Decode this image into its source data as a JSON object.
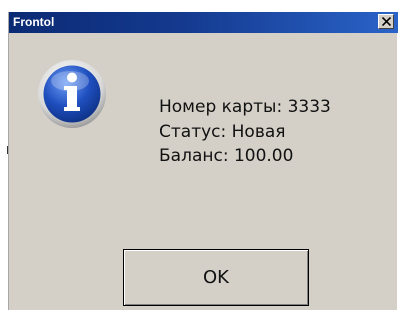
{
  "window": {
    "title": "Frontol"
  },
  "titlebar": {
    "close_icon": "close-icon"
  },
  "dialog": {
    "icon": "info-icon",
    "lines": [
      "Номер карты: 3333",
      "Статус: Новая",
      "Баланс: 100.00"
    ],
    "ok_label": "OK"
  },
  "colors": {
    "titlebar_start": "#0b2a74",
    "titlebar_end": "#2a63c8",
    "dialog_bg": "#d4d0c8",
    "icon_blue": "#1f4fbf"
  }
}
